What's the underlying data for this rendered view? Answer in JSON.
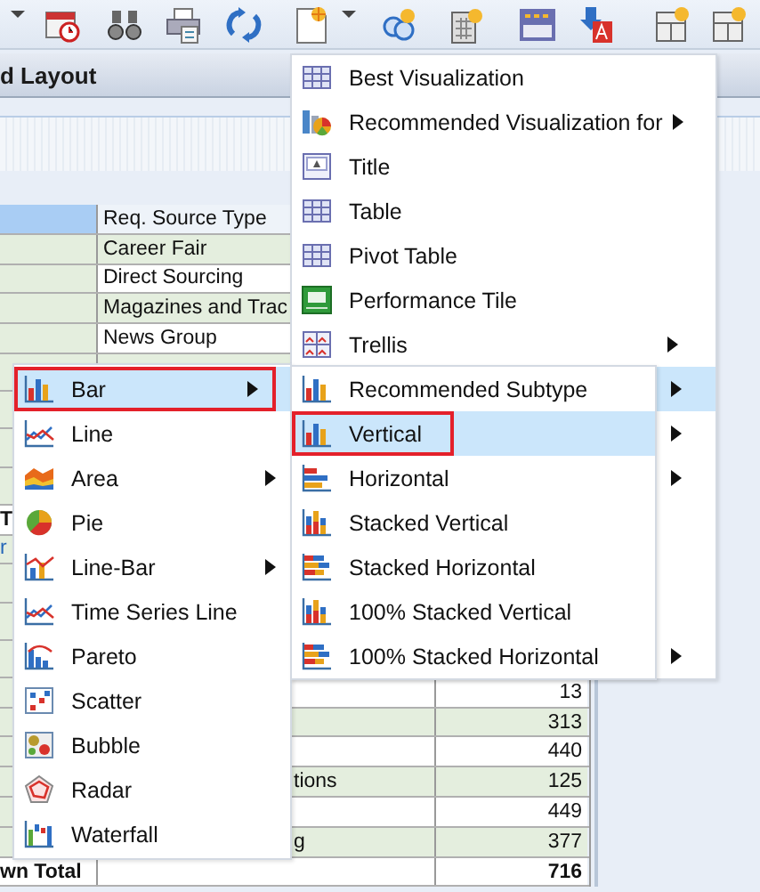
{
  "panel": {
    "title": "d Layout"
  },
  "table": {
    "header": {
      "label": "Req. Source Type"
    },
    "rows": [
      {
        "kind": "data",
        "label": "Career Fair"
      },
      {
        "kind": "data",
        "label": "Direct Sourcing"
      },
      {
        "kind": "data",
        "label": "Magazines and Trac"
      },
      {
        "kind": "data",
        "label": "News Group"
      },
      {
        "kind": "covered"
      },
      {
        "kind": "covered"
      },
      {
        "kind": "covered"
      },
      {
        "kind": "covered"
      },
      {
        "kind": "total",
        "row_header": "T"
      },
      {
        "kind": "link",
        "row_header": "r"
      },
      {
        "kind": "covered"
      },
      {
        "kind": "covered"
      },
      {
        "kind": "covered"
      },
      {
        "kind": "data",
        "value": "13"
      },
      {
        "kind": "data",
        "value": "313"
      },
      {
        "kind": "data",
        "value": "440"
      },
      {
        "kind": "clipped",
        "label": "tions",
        "value": "125"
      },
      {
        "kind": "data",
        "value": "449"
      },
      {
        "kind": "clipped",
        "label": "g",
        "value": "377"
      },
      {
        "kind": "total",
        "row_header": "wn Total",
        "value": "716"
      }
    ]
  },
  "menu": {
    "items": [
      {
        "label": "Best Visualization",
        "selected": false,
        "submenu": false
      },
      {
        "label": "Recommended Visualization for",
        "selected": false,
        "submenu": true
      },
      {
        "label": "Title",
        "selected": false,
        "submenu": false
      },
      {
        "label": "Table",
        "selected": false,
        "submenu": false
      },
      {
        "label": "Pivot Table",
        "selected": false,
        "submenu": false
      },
      {
        "label": "Performance Tile",
        "selected": false,
        "submenu": false
      },
      {
        "label": "Trellis",
        "selected": false,
        "submenu": true
      }
    ],
    "covered_items": [
      {
        "selected": true,
        "submenu": true
      },
      {
        "selected": false,
        "submenu": true
      },
      {
        "selected": false,
        "submenu": true
      },
      {
        "selected": false,
        "submenu": false
      },
      {
        "selected": false,
        "submenu": false
      },
      {
        "selected": false,
        "submenu": false
      },
      {
        "selected": false,
        "submenu": true
      }
    ]
  },
  "chart_type_menu": {
    "items": [
      {
        "label": "Bar",
        "selected": true,
        "submenu": true,
        "outlined": true
      },
      {
        "label": "Line",
        "selected": false,
        "submenu": false,
        "outlined": false
      },
      {
        "label": "Area",
        "selected": false,
        "submenu": true,
        "outlined": false
      },
      {
        "label": "Pie",
        "selected": false,
        "submenu": false,
        "outlined": false
      },
      {
        "label": "Line-Bar",
        "selected": false,
        "submenu": true,
        "outlined": false
      },
      {
        "label": "Time Series Line",
        "selected": false,
        "submenu": false,
        "outlined": false
      },
      {
        "label": "Pareto",
        "selected": false,
        "submenu": false,
        "outlined": false
      },
      {
        "label": "Scatter",
        "selected": false,
        "submenu": false,
        "outlined": false
      },
      {
        "label": "Bubble",
        "selected": false,
        "submenu": false,
        "outlined": false
      },
      {
        "label": "Radar",
        "selected": false,
        "submenu": false,
        "outlined": false
      },
      {
        "label": "Waterfall",
        "selected": false,
        "submenu": false,
        "outlined": false
      }
    ]
  },
  "bar_menu": {
    "items": [
      {
        "label": "Recommended Subtype",
        "selected": false,
        "outlined": false
      },
      {
        "label": "Vertical",
        "selected": true,
        "outlined": true
      },
      {
        "label": "Horizontal",
        "selected": false,
        "outlined": false
      },
      {
        "label": "Stacked Vertical",
        "selected": false,
        "outlined": false
      },
      {
        "label": "Stacked Horizontal",
        "selected": false,
        "outlined": false
      },
      {
        "label": "100% Stacked Vertical",
        "selected": false,
        "outlined": false
      },
      {
        "label": "100% Stacked Horizontal",
        "selected": false,
        "outlined": false
      }
    ]
  }
}
